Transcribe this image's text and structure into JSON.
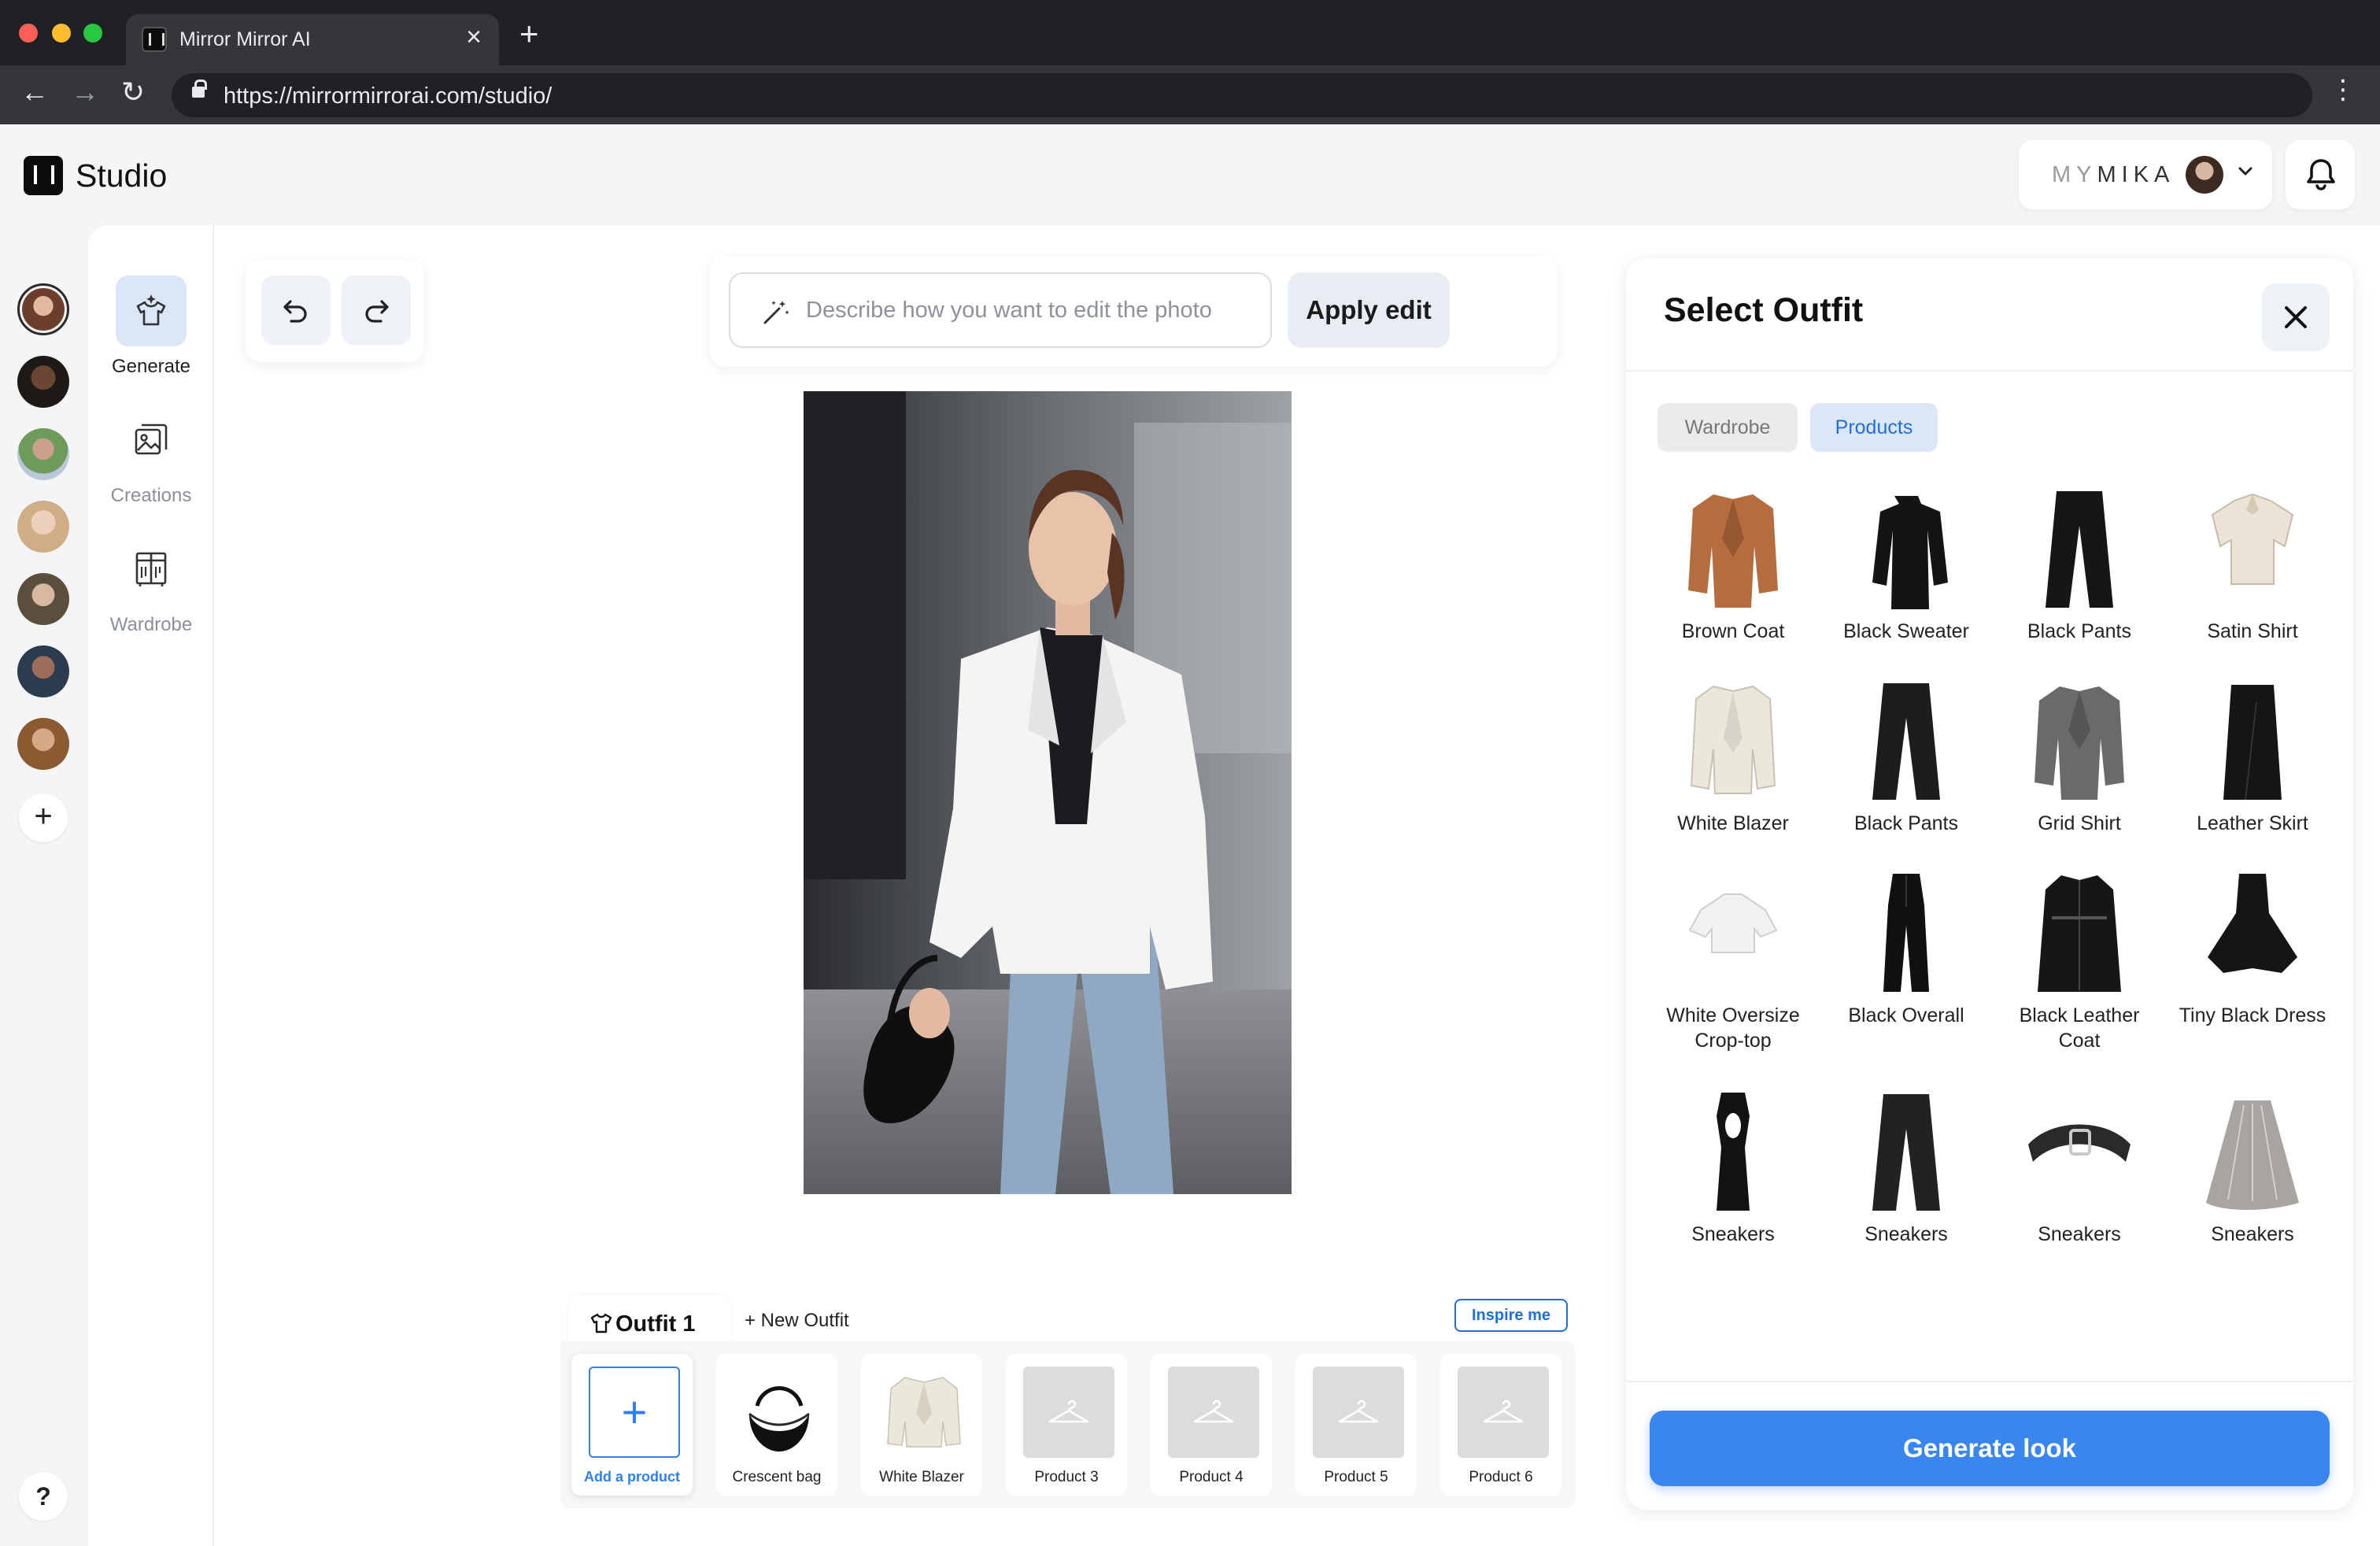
{
  "browser": {
    "tab_title": "Mirror Mirror AI",
    "url": "https://mirrormirrorai.com/studio/"
  },
  "header": {
    "app_title": "Studio",
    "brand_prefix": "MY",
    "brand_name": "MIKA"
  },
  "models": {
    "count": 7,
    "add_label": "+",
    "help_label": "?"
  },
  "sidenav": {
    "items": [
      {
        "label": "Generate",
        "icon": "generate-icon",
        "active": true
      },
      {
        "label": "Creations",
        "icon": "creations-icon",
        "active": false
      },
      {
        "label": "Wardrobe",
        "icon": "wardrobe-icon",
        "active": false
      }
    ]
  },
  "editor": {
    "prompt_placeholder": "Describe how you want to edit the photo",
    "prompt_value": "",
    "apply_label": "Apply edit"
  },
  "outfit": {
    "active_tab": "Outfit 1",
    "new_outfit_label": "+ New Outfit",
    "inspire_label": "Inspire me",
    "slots": [
      {
        "label": "Add a product",
        "kind": "add"
      },
      {
        "label": "Crescent bag",
        "kind": "bag"
      },
      {
        "label": "White Blazer",
        "kind": "blazer"
      },
      {
        "label": "Product 3",
        "kind": "empty"
      },
      {
        "label": "Product 4",
        "kind": "empty"
      },
      {
        "label": "Product 5",
        "kind": "empty"
      },
      {
        "label": "Product 6",
        "kind": "empty"
      }
    ]
  },
  "select_outfit": {
    "title": "Select Outfit",
    "segments": {
      "wardrobe": "Wardrobe",
      "products": "Products",
      "active": "Products"
    },
    "products": [
      {
        "label": "Brown Coat",
        "kind": "coat",
        "color": "#b56d3f"
      },
      {
        "label": "Black Sweater",
        "kind": "sweater",
        "color": "#141414"
      },
      {
        "label": "Black Pants",
        "kind": "pants",
        "color": "#161616"
      },
      {
        "label": "Satin Shirt",
        "kind": "shirt",
        "color": "#ece3d6"
      },
      {
        "label": "White Blazer",
        "kind": "blazer",
        "color": "#ece7db"
      },
      {
        "label": "Black Pants",
        "kind": "pants",
        "color": "#1d1d1d"
      },
      {
        "label": "Grid Shirt",
        "kind": "coat",
        "color": "#6a6a6a"
      },
      {
        "label": "Leather Skirt",
        "kind": "skirt",
        "color": "#151515"
      },
      {
        "label": "White Oversize Crop-top",
        "kind": "crop",
        "color": "#f1f1f1"
      },
      {
        "label": "Black Overall",
        "kind": "overall",
        "color": "#111111"
      },
      {
        "label": "Black Leather Coat",
        "kind": "longcoat",
        "color": "#161616"
      },
      {
        "label": "Tiny Black Dress",
        "kind": "dress",
        "color": "#151515"
      },
      {
        "label": "Sneakers",
        "kind": "bodycon",
        "color": "#121212"
      },
      {
        "label": "Sneakers",
        "kind": "pants",
        "color": "#222222"
      },
      {
        "label": "Sneakers",
        "kind": "belt",
        "color": "#2a2a2a"
      },
      {
        "label": "Sneakers",
        "kind": "silverskirt",
        "color": "#a8a4a0"
      }
    ],
    "generate_label": "Generate look"
  },
  "colors": {
    "accent": "#3a86f1",
    "accent_light": "#dbe7f8",
    "chrome": "#202124"
  }
}
